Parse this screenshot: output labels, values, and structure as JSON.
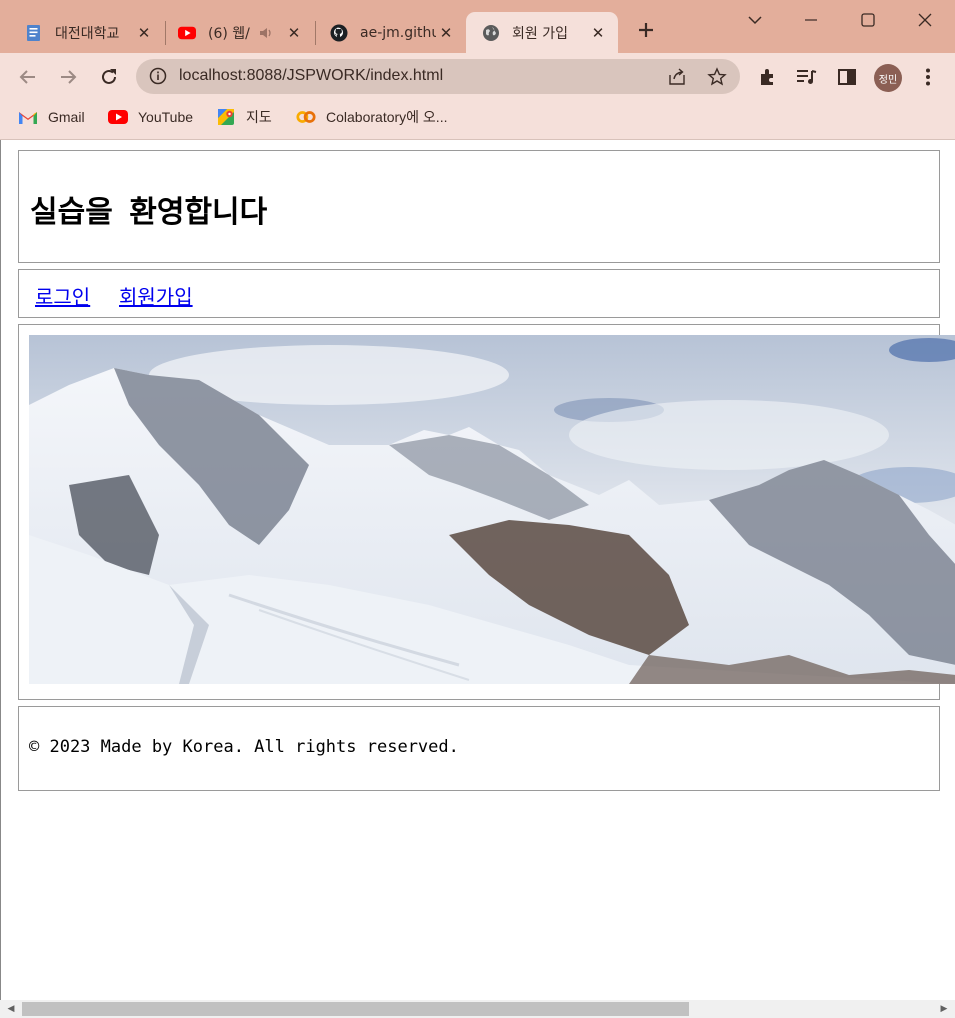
{
  "browser": {
    "tabs": [
      {
        "title": "대전대학교",
        "icon": "document-icon"
      },
      {
        "title": "(6) 웹/",
        "icon": "youtube-icon"
      },
      {
        "title": "ae-jm.githu",
        "icon": "github-icon"
      },
      {
        "title": "회원 가입",
        "icon": "globe-icon",
        "active": true
      }
    ],
    "address": "localhost:8088/JSPWORK/index.html",
    "profile_initials": "정민",
    "bookmarks": [
      {
        "label": "Gmail",
        "icon": "gmail-icon"
      },
      {
        "label": "YouTube",
        "icon": "youtube-icon"
      },
      {
        "label": "지도",
        "icon": "maps-icon"
      },
      {
        "label": "Colaboratory에 오...",
        "icon": "colab-icon"
      }
    ]
  },
  "page": {
    "heading": "실습을 환영합니다",
    "nav": {
      "login": "로그인",
      "signup": "회원가입"
    },
    "banner": {
      "subject": "snowy-mountain-panorama"
    },
    "footer": "© 2023 Made by Korea. All rights reserved."
  },
  "colors": {
    "tabstrip": "#e3ae9b",
    "toolbar": "#f5e0da",
    "link": "#0000ee"
  }
}
